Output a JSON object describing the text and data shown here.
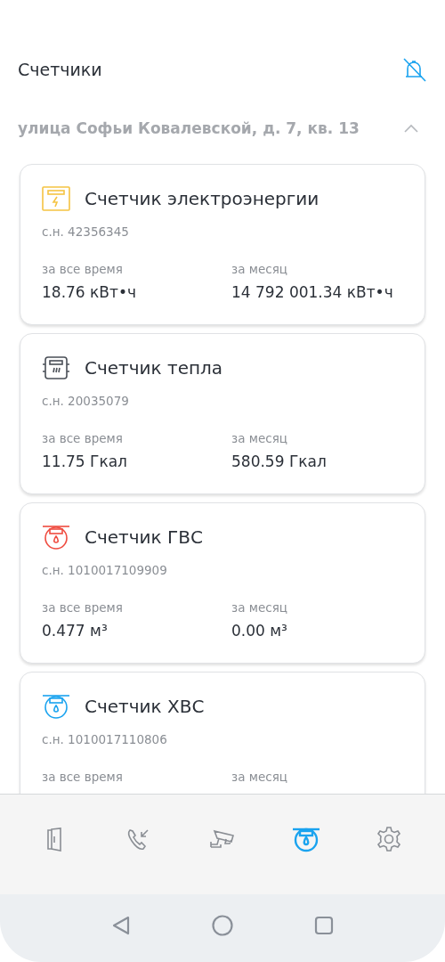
{
  "header": {
    "title": "Счетчики",
    "notifications_muted": true
  },
  "address": {
    "text": "улица Софьи Ковалевской, д. 7, кв. 13",
    "expanded": true
  },
  "meters": [
    {
      "kind": "electric",
      "name": "Счетчик электроэнергии",
      "serial": "с.н. 42356345",
      "readings": [
        {
          "label": "за все время",
          "value": "18.76 кВт•ч"
        },
        {
          "label": "за месяц",
          "value": "14 792 001.34 кВт•ч"
        }
      ]
    },
    {
      "kind": "heat",
      "name": "Счетчик тепла",
      "serial": "с.н. 20035079",
      "readings": [
        {
          "label": "за все время",
          "value": "11.75 Гкал"
        },
        {
          "label": "за месяц",
          "value": "580.59 Гкал"
        }
      ]
    },
    {
      "kind": "hot_water",
      "name": "Счетчик ГВС",
      "serial": "с.н. 1010017109909",
      "readings": [
        {
          "label": "за все время",
          "value": "0.477 м³"
        },
        {
          "label": "за месяц",
          "value": "0.00 м³"
        }
      ]
    },
    {
      "kind": "cold_water",
      "name": "Счетчик ХВС",
      "serial": "с.н. 1010017110806",
      "readings": [
        {
          "label": "за все время"
        },
        {
          "label": "за месяц"
        }
      ]
    }
  ],
  "tab_bar": [
    {
      "kind": "door",
      "selected": false
    },
    {
      "kind": "calls",
      "selected": false
    },
    {
      "kind": "camera",
      "selected": false
    },
    {
      "kind": "meter",
      "selected": true
    },
    {
      "kind": "settings",
      "selected": false
    }
  ],
  "system_nav": [
    {
      "kind": "back"
    },
    {
      "kind": "home"
    },
    {
      "kind": "recents"
    }
  ]
}
